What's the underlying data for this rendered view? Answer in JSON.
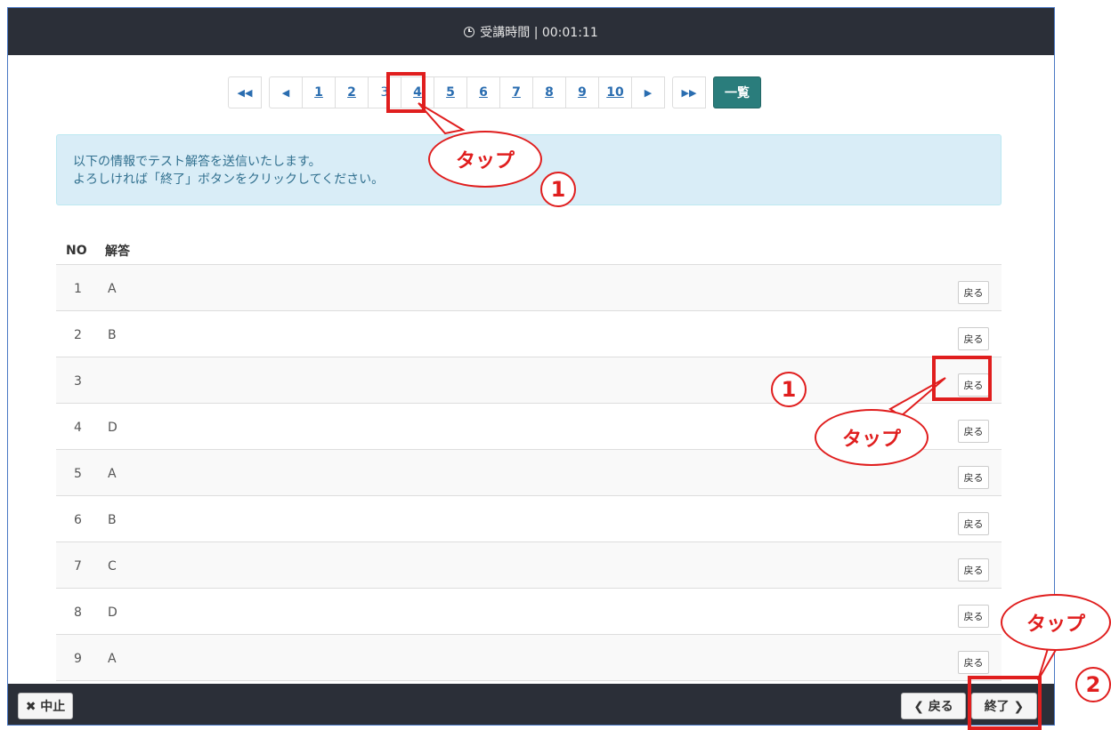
{
  "header": {
    "timer_label": "受講時間 | 00:01:11"
  },
  "pagination": {
    "first_glyph": "◀◀",
    "prev_glyph": "◀",
    "pages": [
      "1",
      "2",
      "3",
      "4",
      "5",
      "6",
      "7",
      "8",
      "9",
      "10"
    ],
    "current_page": "3",
    "next_glyph": "▶",
    "last_glyph": "▶▶",
    "list_label": "一覧"
  },
  "info": {
    "line1": "以下の情報でテスト解答を送信いたします。",
    "line2": "よろしければ「終了」ボタンをクリックしてください。"
  },
  "table": {
    "headers": [
      "NO",
      "解答"
    ],
    "rows": [
      {
        "no": "1",
        "answer": "A",
        "button": "戻る"
      },
      {
        "no": "2",
        "answer": "B",
        "button": "戻る"
      },
      {
        "no": "3",
        "answer": "",
        "button": "戻る"
      },
      {
        "no": "4",
        "answer": "D",
        "button": "戻る"
      },
      {
        "no": "5",
        "answer": "A",
        "button": "戻る"
      },
      {
        "no": "6",
        "answer": "B",
        "button": "戻る"
      },
      {
        "no": "7",
        "answer": "C",
        "button": "戻る"
      },
      {
        "no": "8",
        "answer": "D",
        "button": "戻る"
      },
      {
        "no": "9",
        "answer": "A",
        "button": "戻る"
      }
    ]
  },
  "footer": {
    "cancel_label": "✖ 中止",
    "back_label": "❮ 戻る",
    "finish_label": "終了 ❯"
  },
  "annotations": {
    "tap_label": "タップ",
    "step1": "1",
    "step2": "2",
    "accent_color": "#e01e1e"
  }
}
